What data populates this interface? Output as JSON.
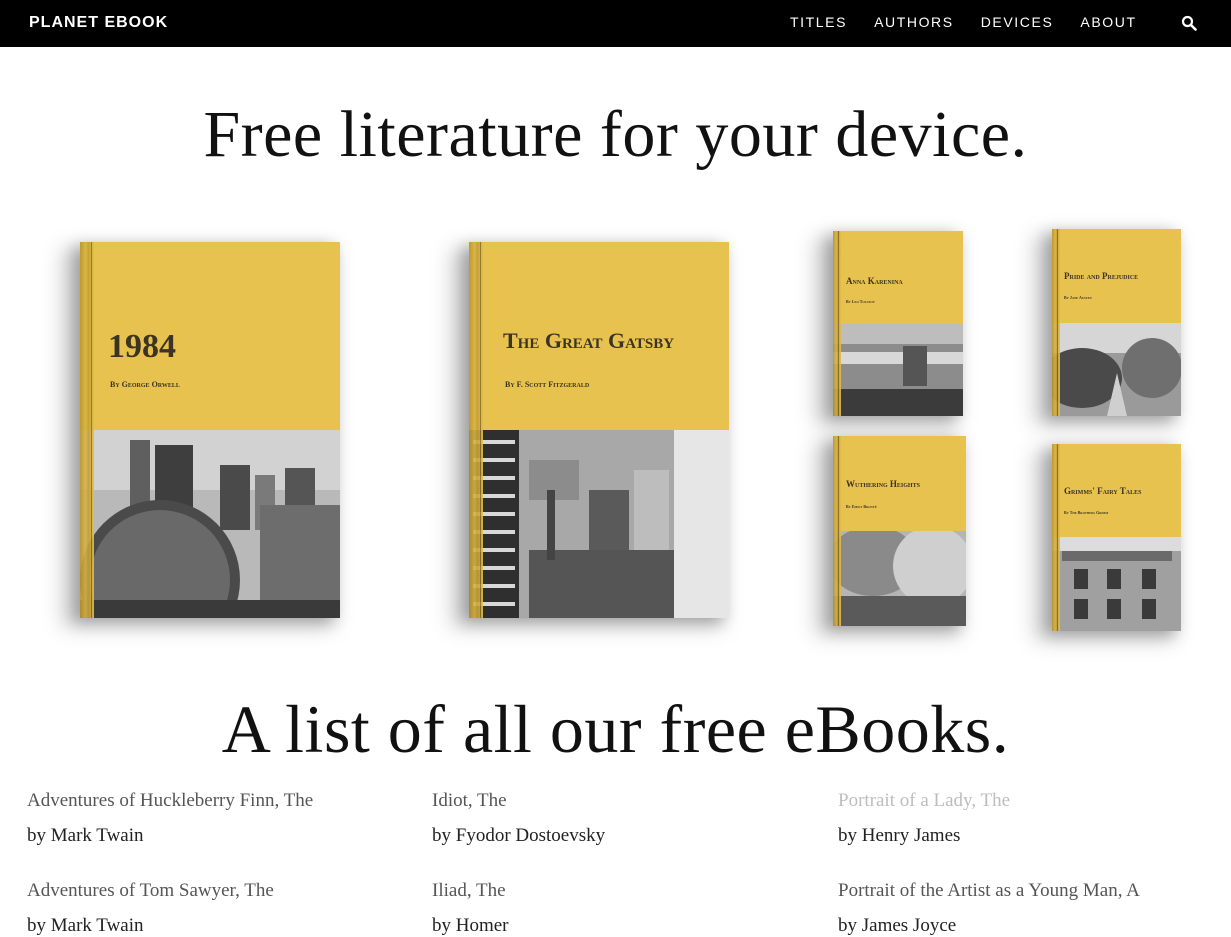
{
  "nav": {
    "brand": "PLANET EBOOK",
    "items": [
      "TITLES",
      "AUTHORS",
      "DEVICES",
      "ABOUT"
    ],
    "search_icon": "search-icon"
  },
  "hero": {
    "heading": "Free literature for your device."
  },
  "books": [
    {
      "title": "1984",
      "author": "By George Orwell"
    },
    {
      "title": "The Great Gatsby",
      "author": "By F. Scott Fitzgerald"
    },
    {
      "title": "Anna Karenina",
      "author": "By Leo Tolstoy"
    },
    {
      "title": "Pride and Prejudice",
      "author": "By Jane Austen"
    },
    {
      "title": "Wuthering Heights",
      "author": "By Emily Brontë"
    },
    {
      "title": "Grimms' Fairy Tales",
      "author": "By The Brothers Grimm"
    }
  ],
  "list_section": {
    "heading": "A list of all our free eBooks."
  },
  "ebooks": [
    {
      "title": "Adventures of Huckleberry Finn, The",
      "author": "by Mark Twain"
    },
    {
      "title": "Idiot, The",
      "author": "by Fyodor Dostoevsky"
    },
    {
      "title": "Portrait of a Lady, The",
      "author": "by Henry James"
    },
    {
      "title": "Adventures of Tom Sawyer, The",
      "author": "by Mark Twain"
    },
    {
      "title": "Iliad, The",
      "author": "by Homer"
    },
    {
      "title": "Portrait of the Artist as a Young Man, A",
      "author": "by James Joyce"
    }
  ],
  "colors": {
    "nav_bg": "#000000",
    "cover_yellow": "#e8c24e"
  }
}
